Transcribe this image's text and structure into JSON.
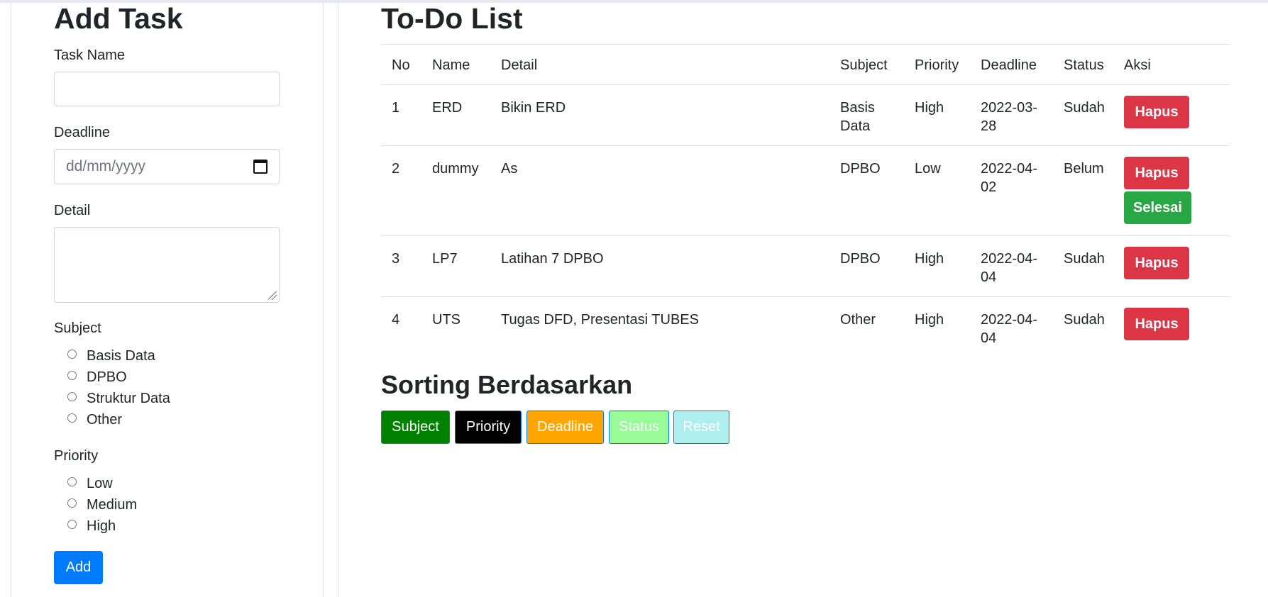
{
  "form": {
    "title": "Add Task",
    "task_name_label": "Task Name",
    "task_name_value": "",
    "deadline_label": "Deadline",
    "deadline_placeholder": "dd/mm/yyyy",
    "detail_label": "Detail",
    "detail_value": "",
    "subject_label": "Subject",
    "subject_options": [
      "Basis Data",
      "DPBO",
      "Struktur Data",
      "Other"
    ],
    "priority_label": "Priority",
    "priority_options": [
      "Low",
      "Medium",
      "High"
    ],
    "add_label": "Add",
    "icons": {
      "deadline": "calendar-icon",
      "detail": "resize-grip-icon"
    }
  },
  "todo": {
    "title": "To-Do List",
    "headers": [
      "No",
      "Name",
      "Detail",
      "Subject",
      "Priority",
      "Deadline",
      "Status",
      "Aksi"
    ],
    "rows": [
      {
        "no": "1",
        "name": "ERD",
        "detail": "Bikin ERD",
        "subject": "Basis Data",
        "priority": "High",
        "deadline": "2022-03-28",
        "status": "Sudah",
        "actions": [
          "Hapus"
        ]
      },
      {
        "no": "2",
        "name": "dummy",
        "detail": "As",
        "subject": "DPBO",
        "priority": "Low",
        "deadline": "2022-04-02",
        "status": "Belum",
        "actions": [
          "Hapus",
          "Selesai"
        ]
      },
      {
        "no": "3",
        "name": "LP7",
        "detail": "Latihan 7 DPBO",
        "subject": "DPBO",
        "priority": "High",
        "deadline": "2022-04-04",
        "status": "Sudah",
        "actions": [
          "Hapus"
        ]
      },
      {
        "no": "4",
        "name": "UTS",
        "detail": "Tugas DFD, Presentasi TUBES",
        "subject": "Other",
        "priority": "High",
        "deadline": "2022-04-04",
        "status": "Sudah",
        "actions": [
          "Hapus"
        ]
      }
    ]
  },
  "sorting": {
    "title": "Sorting Berdasarkan",
    "buttons": [
      "Subject",
      "Priority",
      "Deadline",
      "Status",
      "Reset"
    ]
  },
  "colors": {
    "primary": "#007bff",
    "danger": "#dc3545",
    "success": "#28a745",
    "sort_subject": "#008000",
    "sort_priority": "#000000",
    "sort_deadline": "#ffa500",
    "sort_status": "#98fb98",
    "sort_reset": "#afeeee"
  }
}
